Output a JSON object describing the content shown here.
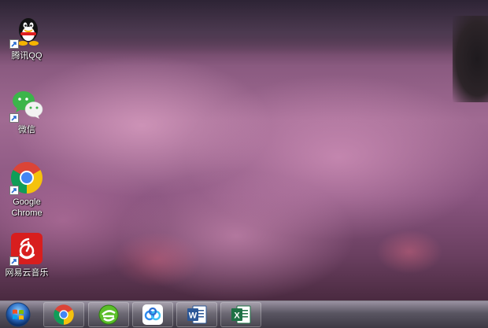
{
  "desktop": {
    "icons": [
      {
        "label": "腾讯QQ",
        "icon": "qq-penguin-icon"
      },
      {
        "label": "微信",
        "icon": "wechat-icon"
      },
      {
        "label": "Google\nChrome",
        "icon": "chrome-icon"
      },
      {
        "label": "网易云音乐",
        "icon": "netease-music-icon"
      }
    ]
  },
  "taskbar": {
    "pinned": [
      {
        "app": "chrome",
        "icon": "chrome-icon"
      },
      {
        "app": "browser",
        "icon": "green-browser-icon"
      },
      {
        "app": "cloud",
        "icon": "baidu-netdisk-icon"
      },
      {
        "app": "word",
        "icon": "word-icon"
      },
      {
        "app": "excel",
        "icon": "excel-icon"
      }
    ]
  },
  "colors": {
    "qq_black": "#111111",
    "qq_yellow": "#f5b400",
    "qq_red": "#e02020",
    "wechat_green": "#3bb54a",
    "chrome_red": "#db4437",
    "chrome_yellow": "#f4c20d",
    "chrome_green": "#0f9d58",
    "chrome_blue": "#4285f4",
    "netease_red": "#d81e1e",
    "word_blue": "#2b5797",
    "excel_green": "#1e7145"
  }
}
